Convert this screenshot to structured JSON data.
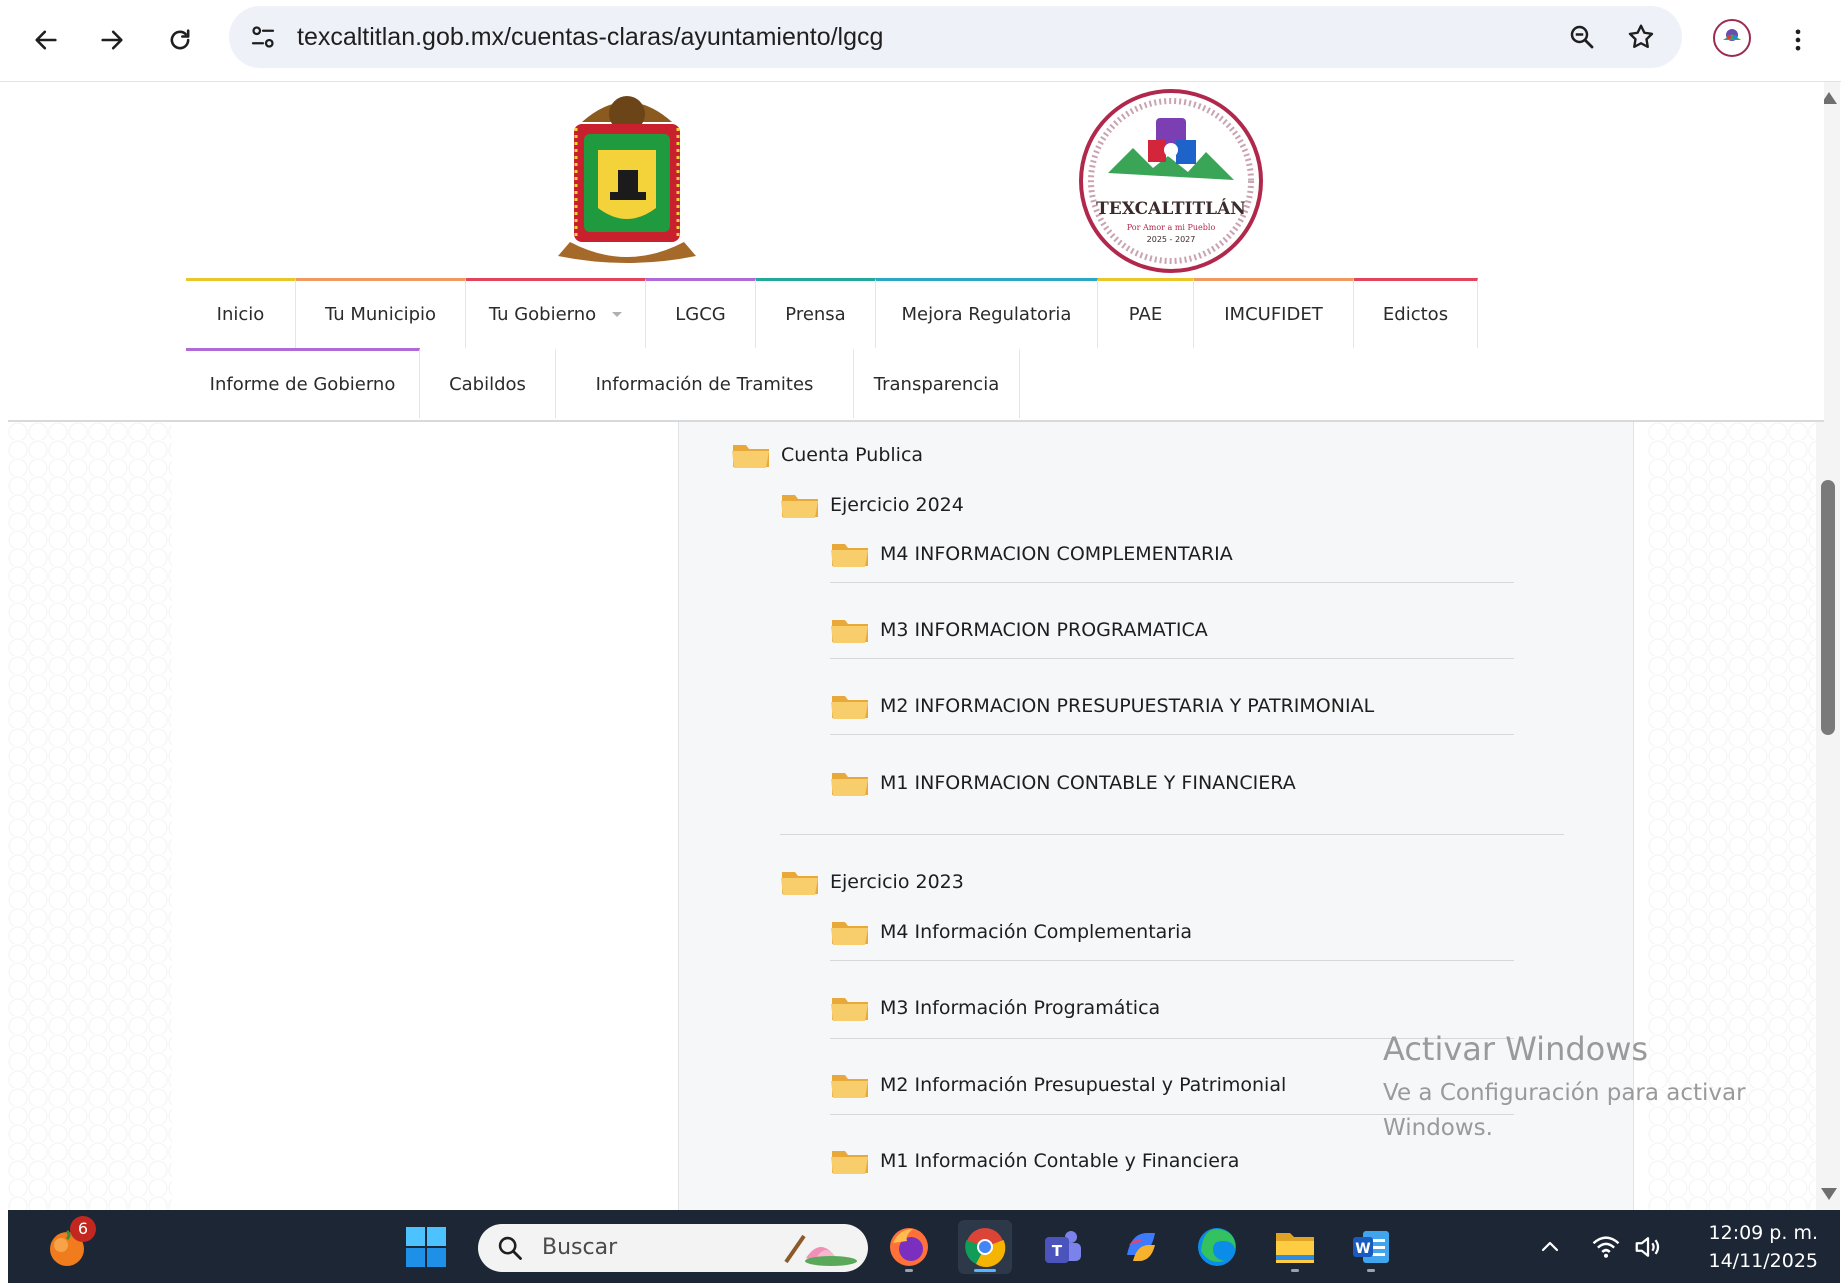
{
  "browser": {
    "url": "texcaltitlan.gob.mx/cuentas-claras/ayuntamiento/lgcg",
    "icons": [
      "back-arrow-icon",
      "forward-arrow-icon",
      "reload-icon",
      "site-settings-icon",
      "zoom-icon",
      "bookmark-star-icon",
      "profile-avatar",
      "menu-dots-icon"
    ]
  },
  "header": {
    "nav_row1": [
      {
        "label": "Inicio",
        "accent": "#e9c72b"
      },
      {
        "label": "Tu Municipio",
        "accent": "#f09a63"
      },
      {
        "label": "Tu Gobierno",
        "accent": "#e2445c"
      },
      {
        "label": "LGCG",
        "accent": "#b06ad8"
      },
      {
        "label": "Prensa",
        "accent": "#22a99a"
      },
      {
        "label": "Mejora Regulatoria",
        "accent": "#2aa7c7"
      },
      {
        "label": "PAE",
        "accent": "#e9c72b"
      },
      {
        "label": "IMCUFIDET",
        "accent": "#f09a63"
      },
      {
        "label": "Edictos",
        "accent": "#e2445c"
      }
    ],
    "nav_row2": [
      {
        "label": "Informe de Gobierno",
        "accent": "#b06ad8"
      },
      {
        "label": "Cabildos",
        "accent": ""
      },
      {
        "label": "Información de Tramites",
        "accent": ""
      },
      {
        "label": "Transparencia",
        "accent": ""
      }
    ]
  },
  "tree": {
    "root": "Cuenta Publica",
    "years": [
      {
        "label": "Ejercicio 2024",
        "items": [
          "M4 INFORMACION COMPLEMENTARIA",
          "M3 INFORMACION PROGRAMATICA",
          "M2 INFORMACION PRESUPUESTARIA Y PATRIMONIAL",
          "M1 INFORMACION CONTABLE Y FINANCIERA"
        ]
      },
      {
        "label": "Ejercicio 2023",
        "items": [
          "M4 Información Complementaria",
          "M3 Información Programática",
          "M2 Información Presupuestal y Patrimonial",
          "M1 Información Contable y Financiera"
        ]
      }
    ]
  },
  "watermark": {
    "title": "Activar Windows",
    "line1": "Ve a Configuración para activar",
    "line2": "Windows."
  },
  "taskbar": {
    "badge": "6",
    "search_placeholder": "Buscar",
    "time": "12:09 p. m.",
    "date": "14/11/2025",
    "apps": [
      "firefox-icon",
      "chrome-icon",
      "teams-icon",
      "copilot-icon",
      "edge-icon",
      "file-explorer-icon",
      "word-icon"
    ]
  },
  "colors": {
    "folder": "#f6c25a",
    "taskbar": "#1c2635"
  }
}
